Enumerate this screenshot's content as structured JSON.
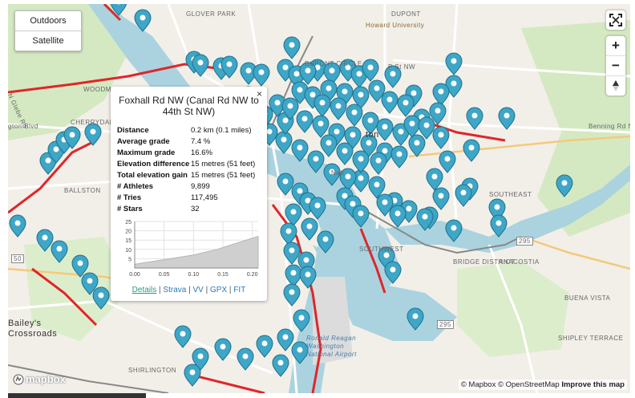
{
  "layers": {
    "outdoors": "Outdoors",
    "satellite": "Satellite"
  },
  "controls": {
    "fullscreen_icon": "fullscreen-icon",
    "zoom_in": "+",
    "zoom_out": "−",
    "compass_icon": "compass-icon"
  },
  "popup": {
    "close": "×",
    "title": "Foxhall Rd NW (Canal Rd NW to 44th St NW)",
    "rows": [
      {
        "label": "Distance",
        "value": "0.2 km (0.1 miles)"
      },
      {
        "label": "Average grade",
        "value": "7.4 %"
      },
      {
        "label": "Maximum grade",
        "value": "16.6%"
      },
      {
        "label": "Elevation difference",
        "value": "15 metres (51 feet)"
      },
      {
        "label": "Total elevation gain",
        "value": "15 metres (51 feet)"
      },
      {
        "label": "# Athletes",
        "value": "9,899"
      },
      {
        "label": "# Tries",
        "value": "117,495"
      },
      {
        "label": "# Stars",
        "value": "32"
      }
    ],
    "links": {
      "details": "Details",
      "strava": "Strava",
      "vv": "VV",
      "gpx": "GPX",
      "fit": "FIT",
      "sep": "|"
    }
  },
  "chart_data": {
    "type": "area",
    "x": [
      0.0,
      0.02,
      0.04,
      0.06,
      0.08,
      0.1,
      0.12,
      0.14,
      0.16,
      0.18,
      0.2,
      0.21
    ],
    "y": [
      2,
      3,
      4,
      5,
      6,
      7,
      8.5,
      10,
      12,
      14,
      16,
      17
    ],
    "xticks": [
      "0.00",
      "0.05",
      "0.10",
      "0.15",
      "0.20"
    ],
    "yticks": [
      "5",
      "10",
      "15",
      "20",
      "25"
    ],
    "xlim": [
      0,
      0.21
    ],
    "ylim": [
      0,
      25
    ],
    "grid": true
  },
  "map_labels": {
    "glover_park": "GLOVER PARK",
    "howard_university": "Howard University",
    "dupont_circle": "DUPONT CIRCLE",
    "woodmont": "WOODMONT",
    "cherrydale": "CHERRYDALE",
    "ballston": "BALLSTON",
    "southeast": "SOUTHEAST",
    "southwest": "SOUTHWEST",
    "bridge_district": "BRIDGE DISTRICT",
    "anacostia": "ANACOSTIA",
    "buena_vista": "BUENA VISTA",
    "shipley_terrace": "SHIPLEY TERRACE",
    "shirlington": "SHIRLINGTON",
    "baileys_crossroads": "Bailey's Crossroads",
    "reagan_airport": "Ronald Reagan Washington National Airport",
    "benning_rd": "Benning Rd NE",
    "p_st": "P St NW",
    "dupont_st": "DUPONT",
    "gton_blvd": "gton Blvd",
    "n_glebe": "N Glebe Rd",
    "ton_frag": "ton",
    "nati": "Nati",
    "route_50": "50",
    "route_295": "295",
    "route_295b": "295"
  },
  "attribution": {
    "mapbox": "© Mapbox",
    "osm": "© OpenStreetMap",
    "improve": "Improve this map",
    "logo": "mapbox"
  },
  "colors": {
    "marker": "#3ea6c7",
    "segment": "#e0262a",
    "water": "#aad3df",
    "park": "#d4e9c2"
  }
}
